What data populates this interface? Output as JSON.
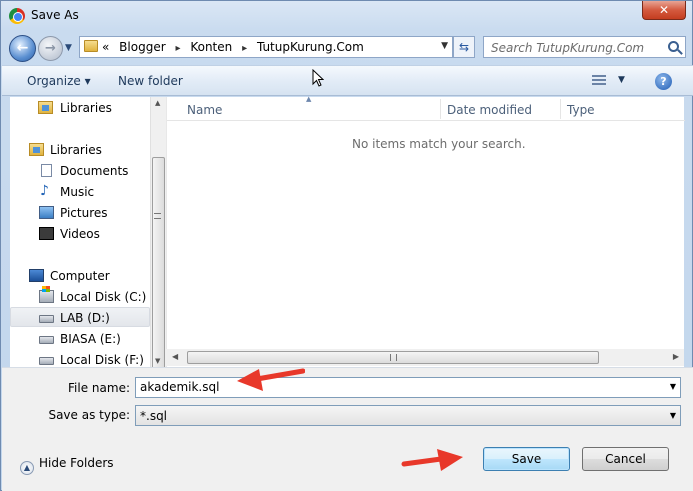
{
  "window": {
    "title": "Save As",
    "close_label": "✕"
  },
  "address": {
    "crumbs": [
      "«",
      "Blogger",
      "Konten",
      "TutupKurung.Com"
    ],
    "separators": [
      "▸",
      "▸"
    ]
  },
  "search": {
    "placeholder": "Search TutupKurung.Com"
  },
  "toolbar": {
    "organize": "Organize ▾",
    "new_folder": "New folder",
    "help": "?"
  },
  "nav": {
    "items": [
      {
        "label": "Libraries",
        "icon": "libraries-icon"
      },
      {
        "label": "Libraries",
        "icon": "libraries-icon"
      },
      {
        "label": "Documents",
        "icon": "documents-icon"
      },
      {
        "label": "Music",
        "icon": "music-icon"
      },
      {
        "label": "Pictures",
        "icon": "pictures-icon"
      },
      {
        "label": "Videos",
        "icon": "videos-icon"
      },
      {
        "label": "Computer",
        "icon": "computer-icon"
      },
      {
        "label": "Local Disk (C:)",
        "icon": "windows-drive-icon"
      },
      {
        "label": "LAB (D:)",
        "icon": "drive-icon",
        "selected": true
      },
      {
        "label": "BIASA (E:)",
        "icon": "drive-icon"
      },
      {
        "label": "Local Disk (F:)",
        "icon": "drive-icon"
      }
    ]
  },
  "content": {
    "columns": [
      "Name",
      "Date modified",
      "Type"
    ],
    "empty_message": "No items match your search."
  },
  "form": {
    "file_name_label": "File name:",
    "file_name_value": "akademik.sql",
    "save_type_label": "Save as type:",
    "save_type_value": "*.sql"
  },
  "footer": {
    "hide_folders": "Hide Folders",
    "save": "Save",
    "cancel": "Cancel"
  },
  "colors": {
    "annotation_arrow": "#e8382a",
    "accent": "#3c7fb1"
  }
}
